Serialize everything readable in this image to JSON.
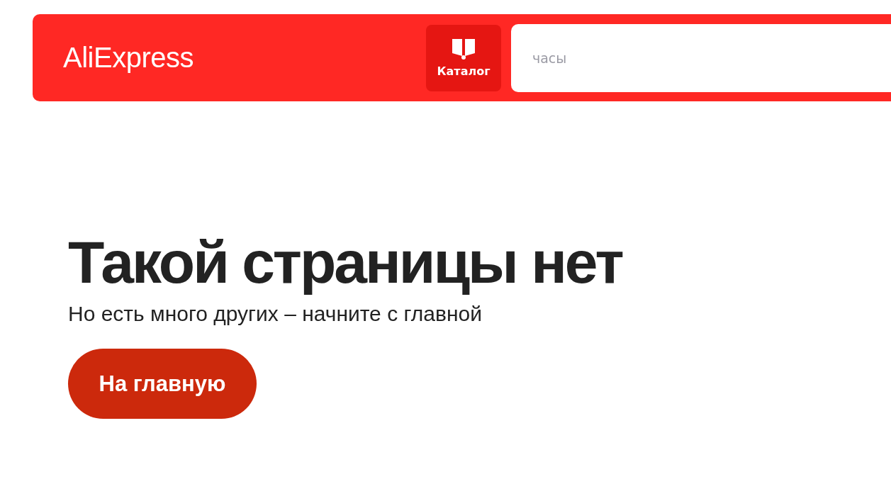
{
  "header": {
    "logo": "AliExpress",
    "catalog_button": "Каталог",
    "search": {
      "placeholder": "часы"
    }
  },
  "error": {
    "title": "Такой страницы нет",
    "subtitle": "Но есть много других – начните с главной",
    "home_button": "На главную"
  }
}
